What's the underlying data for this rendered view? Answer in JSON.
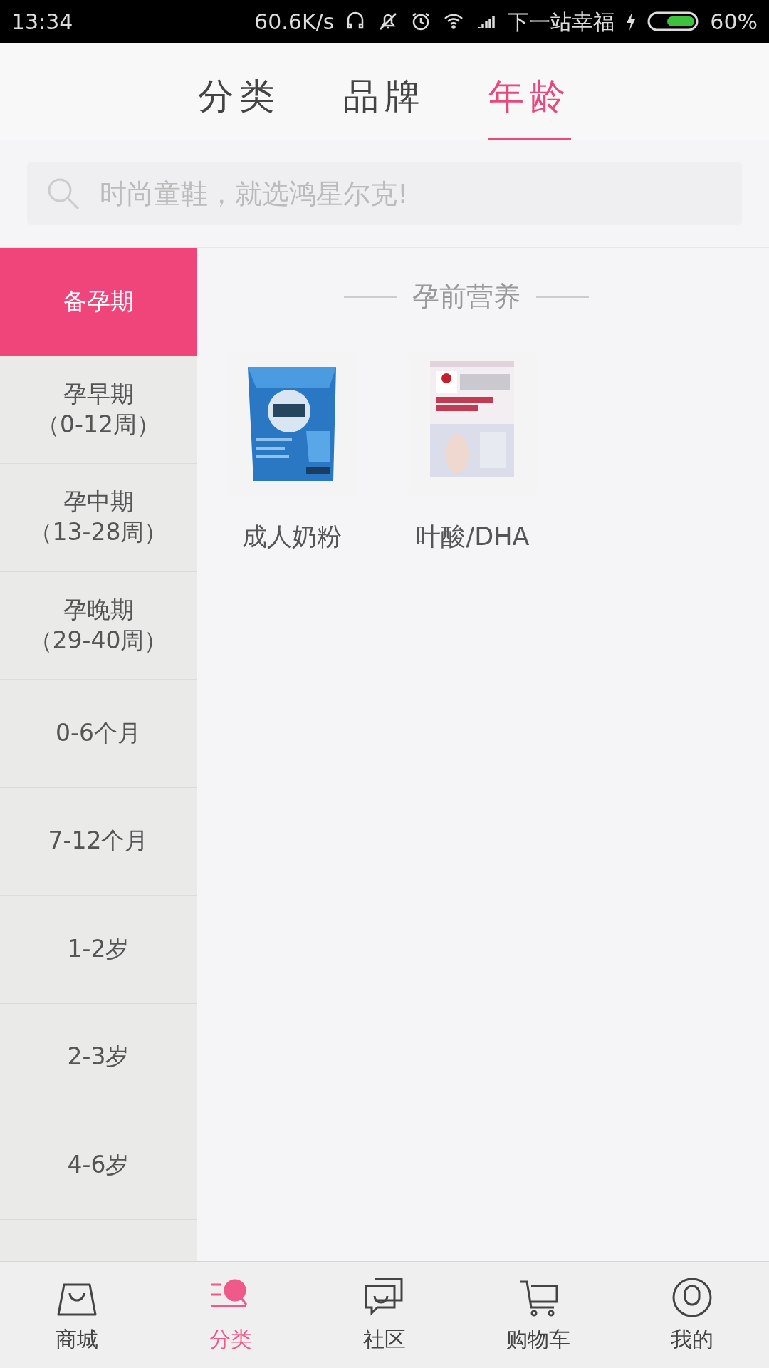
{
  "status_bar": {
    "time": "13:34",
    "speed": "60.6K/s",
    "carrier": "下一站幸福",
    "battery": "60%"
  },
  "tabs": [
    {
      "label": "分类",
      "selected": false
    },
    {
      "label": "品牌",
      "selected": false
    },
    {
      "label": "年龄",
      "selected": true
    }
  ],
  "search": {
    "placeholder": "时尚童鞋，就选鸿星尔克!"
  },
  "sidebar": {
    "items": [
      {
        "label": "备孕期",
        "selected": true
      },
      {
        "label": "孕早期",
        "sub": "（0-12周）",
        "selected": false
      },
      {
        "label": "孕中期",
        "sub": "（13-28周）",
        "selected": false
      },
      {
        "label": "孕晚期",
        "sub": "（29-40周）",
        "selected": false
      },
      {
        "label": "0-6个月",
        "selected": false
      },
      {
        "label": "7-12个月",
        "selected": false
      },
      {
        "label": "1-2岁",
        "selected": false
      },
      {
        "label": "2-3岁",
        "selected": false
      },
      {
        "label": "4-6岁",
        "selected": false
      }
    ]
  },
  "section": {
    "title": "孕前营养",
    "products": [
      {
        "name": "成人奶粉",
        "kind": "bag"
      },
      {
        "name": "叶酸/DHA",
        "kind": "box"
      }
    ]
  },
  "bottom_nav": [
    {
      "label": "商城",
      "selected": false
    },
    {
      "label": "分类",
      "selected": true
    },
    {
      "label": "社区",
      "selected": false
    },
    {
      "label": "购物车",
      "selected": false
    },
    {
      "label": "我的",
      "selected": false
    }
  ]
}
